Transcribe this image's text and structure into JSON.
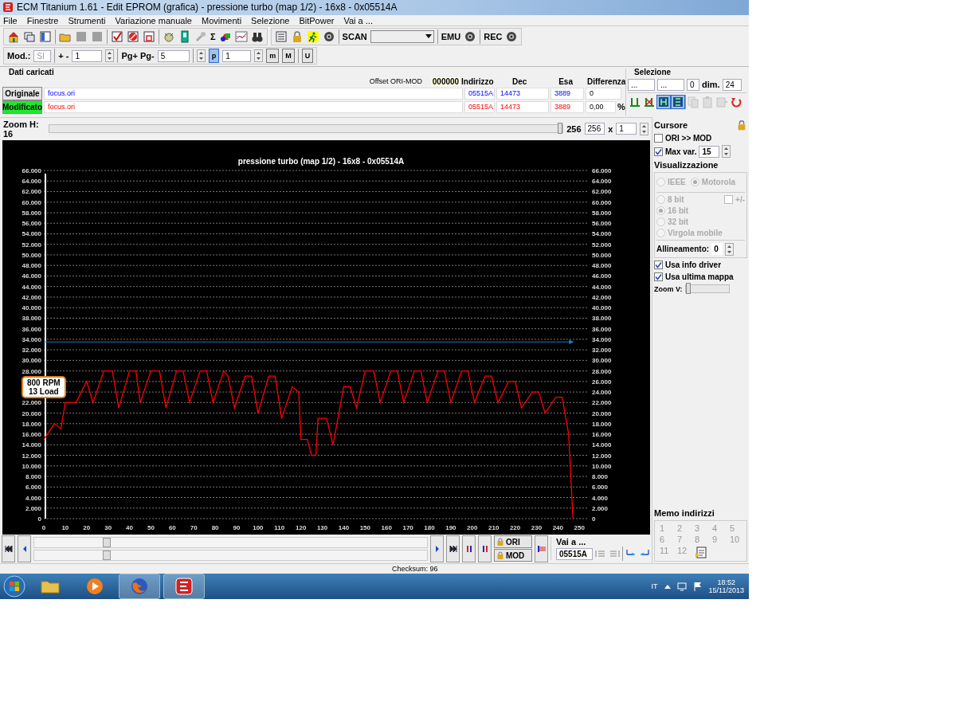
{
  "window": {
    "title": "ECM Titanium 1.61 - Edit EPROM (grafica) - pressione turbo (map 1/2) - 16x8 - 0x05514A"
  },
  "menu": [
    "File",
    "Finestre",
    "Strumenti",
    "Variazione manuale",
    "Movimenti",
    "Selezione",
    "BitPower",
    "Vai a ..."
  ],
  "toolbar": {
    "sum_label": "Σ",
    "scan_label": "SCAN",
    "emu_label": "EMU",
    "rec_label": "REC"
  },
  "toolbar2": {
    "mod_label": "Mod.:",
    "mod_value": "SI",
    "step_label": "+ -",
    "step_value": "1",
    "page_label": "Pg+ Pg-",
    "page_value": "5",
    "p_label": "p",
    "p_selected": true,
    "p_value": "1",
    "m_label": "m",
    "big_m_label": "M",
    "u_label": "U"
  },
  "loaded": {
    "title": "Dati caricati",
    "offset_label": "Offset ORI-MOD",
    "offset_value": "000000",
    "columns": [
      "Indirizzo",
      "Dec",
      "Esa",
      "Differenza"
    ],
    "rows": [
      {
        "kind": "original",
        "button": "Originale",
        "file": "focus.ori",
        "address": "05515A",
        "dec": "14473",
        "hex": "3889",
        "diff": "0"
      },
      {
        "kind": "modified",
        "button": "Modificato",
        "file": "focus.ori",
        "address": "05515A",
        "dec": "14473",
        "hex": "3889",
        "diff": "0,00",
        "unit": "%"
      }
    ]
  },
  "selection": {
    "title": "Selezione",
    "start": "...",
    "end": "...",
    "count": "0",
    "dim_label": "dim.",
    "dim_value": "24",
    "tools": [
      {
        "kind": "bars",
        "selected": false,
        "disabled": false
      },
      {
        "kind": "bars-x",
        "selected": false,
        "disabled": false
      },
      {
        "kind": "block-h",
        "selected": true,
        "disabled": false
      },
      {
        "kind": "block-e",
        "selected": true,
        "disabled": false
      },
      {
        "kind": "copy",
        "selected": false,
        "disabled": true
      },
      {
        "kind": "paste",
        "selected": false,
        "disabled": true
      },
      {
        "kind": "paste2",
        "selected": false,
        "disabled": true
      },
      {
        "kind": "undo",
        "selected": false,
        "disabled": false
      }
    ]
  },
  "zoom_h": {
    "label": "Zoom H: 16",
    "level": 1,
    "reading": "256",
    "value": "256",
    "times": "x",
    "factor": "1"
  },
  "chart": {
    "tooltip": [
      "800 RPM",
      "13 Load"
    ],
    "chart_data": {
      "type": "line",
      "title": "pressione turbo (map 1/2) - 16x8 - 0x05514A",
      "x": [
        0,
        5,
        8,
        10,
        15,
        20,
        23,
        28,
        32,
        35,
        40,
        43,
        45,
        50,
        54,
        57,
        62,
        65,
        68,
        73,
        76,
        79,
        84,
        86,
        89,
        94,
        97,
        100,
        105,
        108,
        111,
        116,
        119,
        120,
        123,
        125,
        127,
        128,
        132,
        135,
        140,
        143,
        146,
        150,
        154,
        157,
        162,
        165,
        168,
        173,
        176,
        179,
        184,
        187,
        190,
        195,
        198,
        201,
        206,
        209,
        212,
        217,
        220,
        223,
        228,
        231,
        234,
        239,
        242,
        245,
        247
      ],
      "series": [
        {
          "color": "#ff0000",
          "values": [
            15,
            18,
            17,
            22,
            22,
            26,
            22,
            28,
            28,
            21,
            28,
            28,
            22,
            28,
            28,
            21,
            28,
            28,
            22,
            28,
            28,
            22,
            28,
            27,
            21,
            27,
            27,
            20,
            27,
            27,
            19,
            25,
            24,
            15,
            15,
            12,
            12,
            19,
            19,
            14,
            25,
            25,
            21,
            28,
            28,
            22,
            28,
            28,
            22,
            28,
            28,
            22,
            28,
            28,
            22,
            28,
            28,
            22,
            27,
            27,
            22,
            26,
            26,
            21,
            24,
            24,
            20,
            23,
            23,
            16,
            0
          ]
        },
        {
          "color": "#1e78c8",
          "values": [
            33.5,
            33.5,
            33.5,
            33.5,
            33.5,
            33.5,
            33.5,
            33.5,
            33.5,
            33.5,
            33.5,
            33.5,
            33.5,
            33.5,
            33.5,
            33.5,
            33.5,
            33.5,
            33.5,
            33.5,
            33.5,
            33.5,
            33.5,
            33.5,
            33.5,
            33.5,
            33.5,
            33.5,
            33.5,
            33.5,
            33.5,
            33.5,
            33.5,
            33.5,
            33.5,
            33.5,
            33.5,
            33.5,
            33.5,
            33.5,
            33.5,
            33.5,
            33.5,
            33.5,
            33.5,
            33.5,
            33.5,
            33.5,
            33.5,
            33.5,
            33.5,
            33.5,
            33.5,
            33.5,
            33.5,
            33.5,
            33.5,
            33.5,
            33.5,
            33.5,
            33.5,
            33.5,
            33.5,
            33.5,
            33.5,
            33.5,
            33.5,
            33.5,
            33.5,
            33.5,
            33.5
          ]
        }
      ],
      "xlim": [
        0,
        254
      ],
      "ylim": [
        0,
        66
      ],
      "grid": true,
      "xticks": [
        0,
        10,
        20,
        30,
        40,
        50,
        60,
        70,
        80,
        90,
        100,
        110,
        120,
        130,
        140,
        150,
        160,
        170,
        180,
        190,
        200,
        210,
        220,
        230,
        240,
        250
      ],
      "yticks": [
        {
          "value": 0,
          "label": "0"
        },
        {
          "value": 2,
          "label": "2.000"
        },
        {
          "value": 4,
          "label": "4.000"
        },
        {
          "value": 6,
          "label": "6.000"
        },
        {
          "value": 8,
          "label": "8.000"
        },
        {
          "value": 10,
          "label": "10.000"
        },
        {
          "value": 12,
          "label": "12.000"
        },
        {
          "value": 14,
          "label": "14.000"
        },
        {
          "value": 16,
          "label": "16.000"
        },
        {
          "value": 18,
          "label": "18.000"
        },
        {
          "value": 20,
          "label": "20.000"
        },
        {
          "value": 22,
          "label": "22.000"
        },
        {
          "value": 24,
          "label": "24.000"
        },
        {
          "value": 26,
          "label": "26.000"
        },
        {
          "value": 28,
          "label": "28.000"
        },
        {
          "value": 30,
          "label": "30.000"
        },
        {
          "value": 32,
          "label": "32.000"
        },
        {
          "value": 34,
          "label": "34.000"
        },
        {
          "value": 36,
          "label": "36.000"
        },
        {
          "value": 38,
          "label": "38.000"
        },
        {
          "value": 40,
          "label": "40.000"
        },
        {
          "value": 42,
          "label": "42.000"
        },
        {
          "value": 44,
          "label": "44.000"
        },
        {
          "value": 46,
          "label": "46.000"
        },
        {
          "value": 48,
          "label": "48.000"
        },
        {
          "value": 50,
          "label": "50.000"
        },
        {
          "value": 52,
          "label": "52.000"
        },
        {
          "value": 54,
          "label": "54.000"
        },
        {
          "value": 56,
          "label": "56.000"
        },
        {
          "value": 58,
          "label": "58.000"
        },
        {
          "value": 60,
          "label": "60.000"
        },
        {
          "value": 62,
          "label": "62.000"
        },
        {
          "value": 64,
          "label": "64.000"
        },
        {
          "value": 66,
          "label": "66.000"
        }
      ]
    }
  },
  "cursor": {
    "title": "Cursore",
    "ori_mod": {
      "label": "ORI >> MOD",
      "checked": false
    },
    "max_var": {
      "label": "Max var.",
      "checked": true,
      "value": "15"
    }
  },
  "display": {
    "title": "Visualizzazione",
    "byte_order": [
      {
        "label": "IEEE",
        "selected": false,
        "disabled": true
      },
      {
        "label": "Motorola",
        "selected": true,
        "disabled": true
      }
    ],
    "width": [
      {
        "label": "8 bit",
        "selected": false,
        "disabled": true
      },
      {
        "label": "16 bit",
        "selected": true,
        "disabled": true
      },
      {
        "label": "32 bit",
        "selected": false,
        "disabled": true
      },
      {
        "label": "Virgola mobile",
        "selected": false,
        "disabled": true
      }
    ],
    "sign": {
      "label": "+/-",
      "checked": false,
      "disabled": true
    },
    "alignment": {
      "label": "Allineamento:",
      "value": "0"
    },
    "options": [
      {
        "label": "Usa info driver",
        "checked": true
      },
      {
        "label": "Usa ultima mappa",
        "checked": true
      }
    ],
    "zoom_v": {
      "label": "Zoom V:",
      "level": 0
    }
  },
  "memo": {
    "title": "Memo indirizzi",
    "slots": [
      {
        "label": "1",
        "disabled": true
      },
      {
        "label": "2",
        "disabled": true
      },
      {
        "label": "3",
        "disabled": true
      },
      {
        "label": "4",
        "disabled": true
      },
      {
        "label": "5",
        "disabled": true
      },
      {
        "label": "6",
        "disabled": true
      },
      {
        "label": "7",
        "disabled": true
      },
      {
        "label": "8",
        "disabled": true
      },
      {
        "label": "9",
        "disabled": true
      },
      {
        "label": "10",
        "disabled": true
      },
      {
        "label": "11",
        "disabled": true
      },
      {
        "label": "12",
        "disabled": true
      }
    ]
  },
  "navigation": {
    "ori_label": "ORI",
    "mod_label": "MOD",
    "goto_label": "Vai a ...",
    "goto_value": "05515A"
  },
  "status_bar": {
    "checksum": "Checksum: 96"
  },
  "taskbar": {
    "language": "IT",
    "time": "18:52",
    "date": "15/11/2013",
    "apps": [
      {
        "kind": "explorer",
        "selected": false
      },
      {
        "kind": "media",
        "selected": false
      },
      {
        "kind": "firefox",
        "selected": true
      },
      {
        "kind": "ecm",
        "selected": true
      }
    ]
  }
}
